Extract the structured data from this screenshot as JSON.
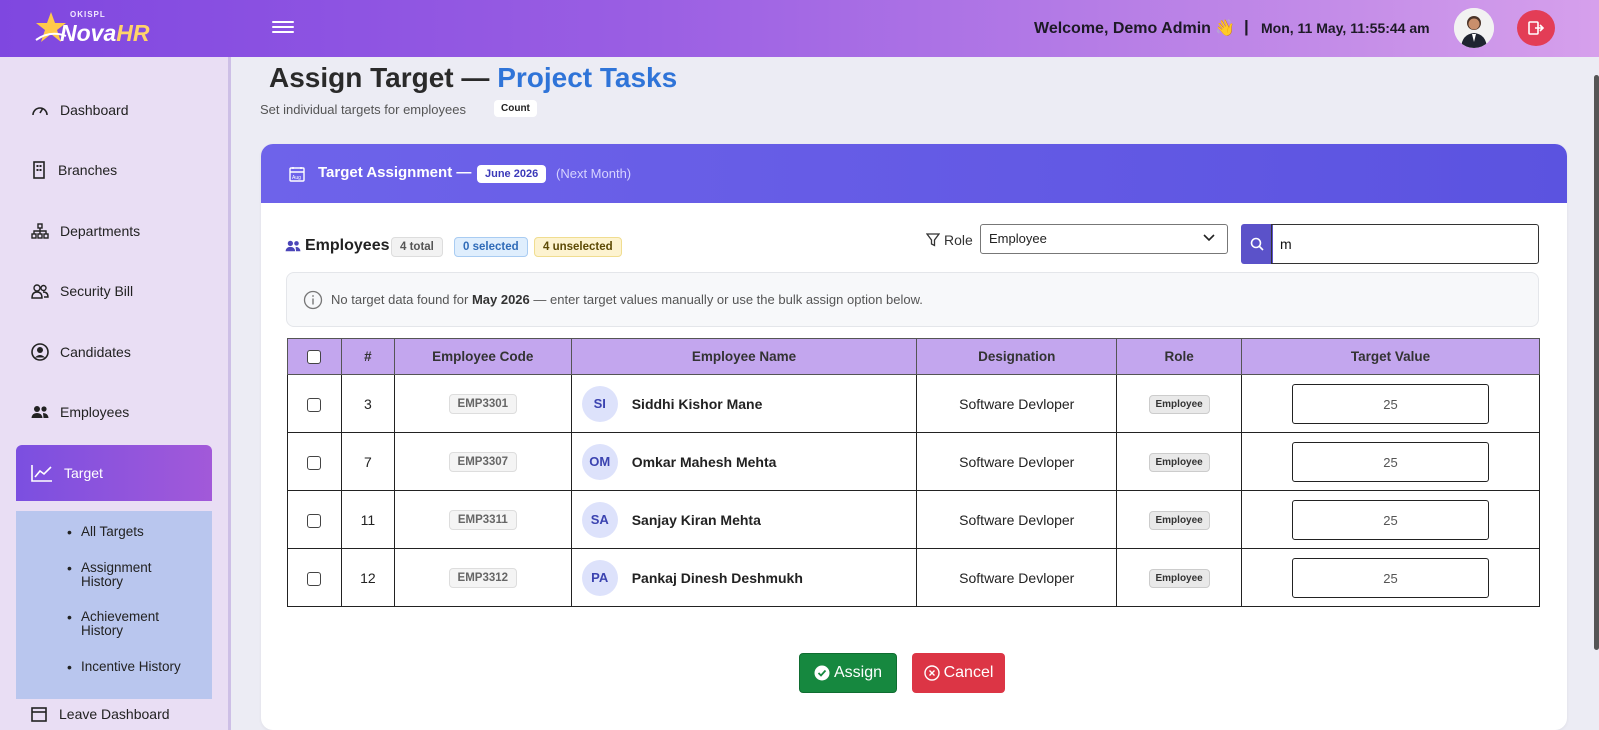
{
  "header": {
    "logo_small": "OKISPL",
    "logo_main": "Nova",
    "logo_accent": "HR",
    "welcome": "Welcome, Demo Admin 👋",
    "separator": "|",
    "datetime": "Mon, 11 May, 11:55:44 am"
  },
  "sidebar": {
    "items": [
      {
        "label": "Dashboard",
        "icon": "dashboard-icon"
      },
      {
        "label": "Branches",
        "icon": "building-icon"
      },
      {
        "label": "Departments",
        "icon": "sitemap-icon"
      },
      {
        "label": "Security Bill",
        "icon": "users-icon"
      },
      {
        "label": "Candidates",
        "icon": "user-circle-icon"
      },
      {
        "label": "Employees",
        "icon": "people-icon"
      },
      {
        "label": "Target",
        "icon": "chart-line-icon",
        "active": true
      }
    ],
    "submenu": [
      "All Targets",
      "Assignment History",
      "Achievement History",
      "Incentive History"
    ],
    "partial_item": "Leave Dashboard"
  },
  "page": {
    "title_main": "Assign Target — ",
    "title_accent": "Project Tasks",
    "subtitle": "Set individual targets for employees",
    "count_badge": "Count"
  },
  "card": {
    "title": "Target Assignment —",
    "month": "June 2026",
    "next": "(Next Month)",
    "employees_label": "Employees",
    "total_pill": "4 total",
    "selected_pill": "0 selected",
    "unselected_pill": "4 unselected",
    "role_label": "Role",
    "role_value": "Employee",
    "search_value": "m",
    "info_prefix": "No target data found for",
    "info_month": "May 2026",
    "info_suffix": "— enter target values manually or use the bulk assign option below.",
    "assign_label": "Assign",
    "cancel_label": "Cancel"
  },
  "table": {
    "headers": [
      "#",
      "Employee Code",
      "Employee Name",
      "Designation",
      "Role",
      "Target Value"
    ],
    "rows": [
      {
        "num": "3",
        "code": "EMP3301",
        "initials": "SI",
        "name": "Siddhi Kishor Mane",
        "designation": "Software Devloper",
        "role": "Employee",
        "target": "25"
      },
      {
        "num": "7",
        "code": "EMP3307",
        "initials": "OM",
        "name": "Omkar Mahesh Mehta",
        "designation": "Software Devloper",
        "role": "Employee",
        "target": "25"
      },
      {
        "num": "11",
        "code": "EMP3311",
        "initials": "SA",
        "name": "Sanjay Kiran Mehta",
        "designation": "Software Devloper",
        "role": "Employee",
        "target": "25"
      },
      {
        "num": "12",
        "code": "EMP3312",
        "initials": "PA",
        "name": "Pankaj Dinesh Deshmukh",
        "designation": "Software Devloper",
        "role": "Employee",
        "target": "25"
      }
    ]
  },
  "colors": {
    "accent": "#2f74d8",
    "header_purple": "#7f47e0",
    "assign_green": "#16883f",
    "cancel_red": "#dc3545"
  }
}
